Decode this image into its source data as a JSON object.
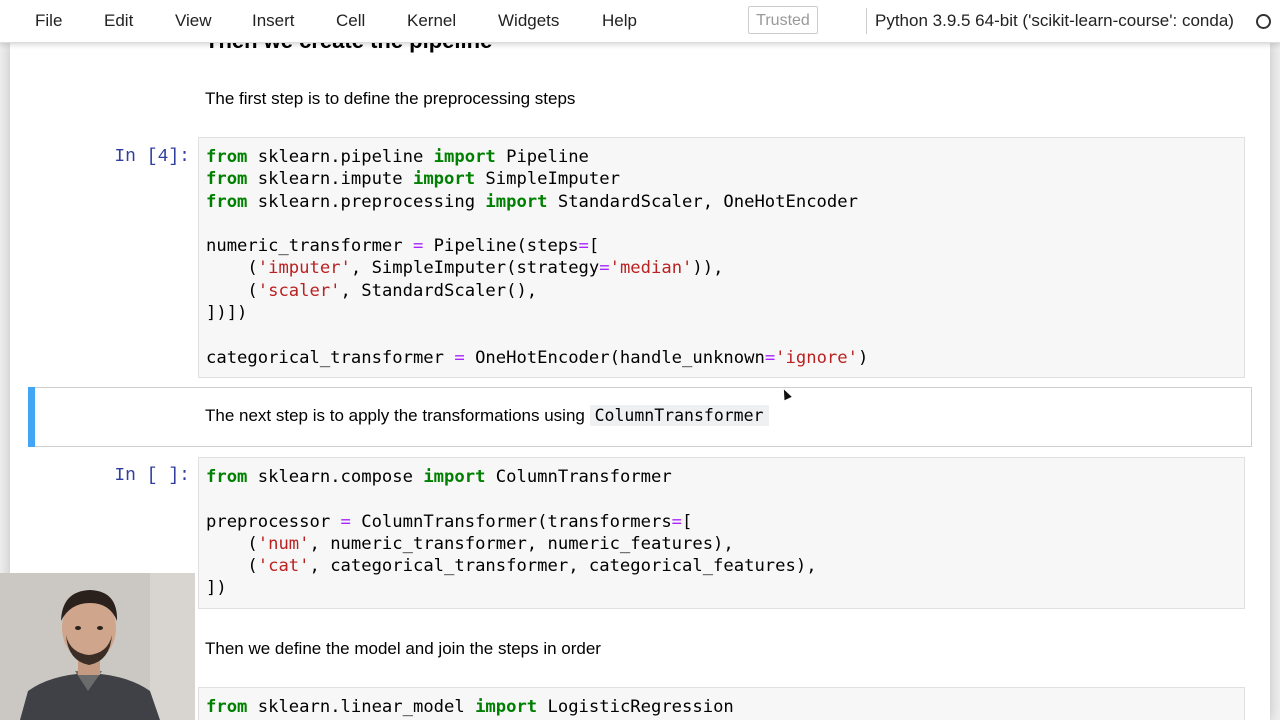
{
  "menu": {
    "items": [
      "File",
      "Edit",
      "View",
      "Insert",
      "Cell",
      "Kernel",
      "Widgets",
      "Help"
    ],
    "trusted_label": "Trusted",
    "kernel_name": "Python 3.9.5 64-bit ('scikit-learn-course': conda)"
  },
  "cells": {
    "heading_partial": "Then we create the pipeline",
    "md1": "The first step is to define the preprocessing steps",
    "prompt1": "In [4]:",
    "code1": [
      [
        [
          "kw",
          "from"
        ],
        [
          "t",
          " sklearn.pipeline "
        ],
        [
          "kw",
          "import"
        ],
        [
          "t",
          " Pipeline"
        ]
      ],
      [
        [
          "kw",
          "from"
        ],
        [
          "t",
          " sklearn.impute "
        ],
        [
          "kw",
          "import"
        ],
        [
          "t",
          " SimpleImputer"
        ]
      ],
      [
        [
          "kw",
          "from"
        ],
        [
          "t",
          " sklearn.preprocessing "
        ],
        [
          "kw",
          "import"
        ],
        [
          "t",
          " StandardScaler, OneHotEncoder"
        ]
      ],
      [],
      [
        [
          "t",
          "numeric_transformer "
        ],
        [
          "op",
          "="
        ],
        [
          "t",
          " Pipeline(steps"
        ],
        [
          "op",
          "="
        ],
        [
          "t",
          "["
        ]
      ],
      [
        [
          "t",
          "    ("
        ],
        [
          "st",
          "'imputer'"
        ],
        [
          "t",
          ", SimpleImputer(strategy"
        ],
        [
          "op",
          "="
        ],
        [
          "st",
          "'median'"
        ],
        [
          "t",
          ")),"
        ]
      ],
      [
        [
          "t",
          "    ("
        ],
        [
          "st",
          "'scaler'"
        ],
        [
          "t",
          ", StandardScaler(),"
        ]
      ],
      [
        [
          "t",
          "])"
        ],
        [
          "t",
          "])"
        ]
      ],
      [],
      [
        [
          "t",
          "categorical_transformer "
        ],
        [
          "op",
          "="
        ],
        [
          "t",
          " OneHotEncoder(handle_unknown"
        ],
        [
          "op",
          "="
        ],
        [
          "st",
          "'ignore'"
        ],
        [
          "t",
          ")"
        ]
      ]
    ],
    "md2_text": "The next step is to apply the transformations using",
    "md2_code": "ColumnTransformer",
    "prompt2": "In [ ]:",
    "code2": [
      [
        [
          "kw",
          "from"
        ],
        [
          "t",
          " sklearn.compose "
        ],
        [
          "kw",
          "import"
        ],
        [
          "t",
          " ColumnTransformer"
        ]
      ],
      [],
      [
        [
          "t",
          "preprocessor "
        ],
        [
          "op",
          "="
        ],
        [
          "t",
          " ColumnTransformer(transformers"
        ],
        [
          "op",
          "="
        ],
        [
          "t",
          "["
        ]
      ],
      [
        [
          "t",
          "    ("
        ],
        [
          "st",
          "'num'"
        ],
        [
          "t",
          ", numeric_transformer, numeric_features),"
        ]
      ],
      [
        [
          "t",
          "    ("
        ],
        [
          "st",
          "'cat'"
        ],
        [
          "t",
          ", categorical_transformer, categorical_features),"
        ]
      ],
      [
        [
          "t",
          "])"
        ]
      ]
    ],
    "md3": "Then we define the model and join the steps in order",
    "code3": [
      [
        [
          "kw",
          "from"
        ],
        [
          "t",
          " sklearn.linear_model "
        ],
        [
          "kw",
          "import"
        ],
        [
          "t",
          " LogisticRegression"
        ]
      ]
    ]
  },
  "colors": {
    "keyword": "#008000",
    "string": "#ba2121",
    "operator": "#aa22ff",
    "prompt": "#303f9f",
    "selected_bar": "#42a5f5"
  }
}
